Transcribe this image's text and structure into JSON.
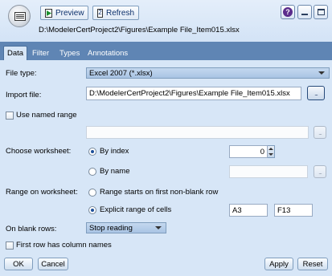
{
  "toolbar": {
    "preview_label": "Preview",
    "refresh_label": "Refresh",
    "help_glyph": "?",
    "file_path_title": "D:\\ModelerCertProject2\\Figures\\Example File_Item015.xlsx",
    "app_icon": "excel-source-node-icon"
  },
  "tabs": [
    {
      "label": "Data",
      "active": true
    },
    {
      "label": "Filter",
      "active": false
    },
    {
      "label": "Types",
      "active": false
    },
    {
      "label": "Annotations",
      "active": false
    }
  ],
  "form": {
    "file_type_label": "File type:",
    "file_type_value": "Excel 2007 (*.xlsx)",
    "import_file_label": "Import file:",
    "import_file_value": "D:\\ModelerCertProject2\\Figures\\Example File_Item015.xlsx",
    "browse_glyph": "...",
    "use_named_range_label": "Use named range",
    "named_range_value": "",
    "choose_worksheet_label": "Choose worksheet:",
    "by_index_label": "By index",
    "index_value": "0",
    "by_name_label": "By name",
    "by_name_value": "",
    "range_on_worksheet_label": "Range on worksheet:",
    "range_first_row_label": "Range starts on first non-blank row",
    "explicit_range_label": "Explicit range of cells",
    "range_start": "A3",
    "range_end": "F13",
    "on_blank_rows_label": "On blank rows:",
    "on_blank_rows_value": "Stop reading",
    "first_row_names_label": "First row has column names"
  },
  "buttons": {
    "ok": "OK",
    "cancel": "Cancel",
    "apply": "Apply",
    "reset": "Reset"
  },
  "colors": {
    "background": "#d7e6f7",
    "tab_strip": "#5f85b4",
    "accent": "#1d4f9a"
  }
}
